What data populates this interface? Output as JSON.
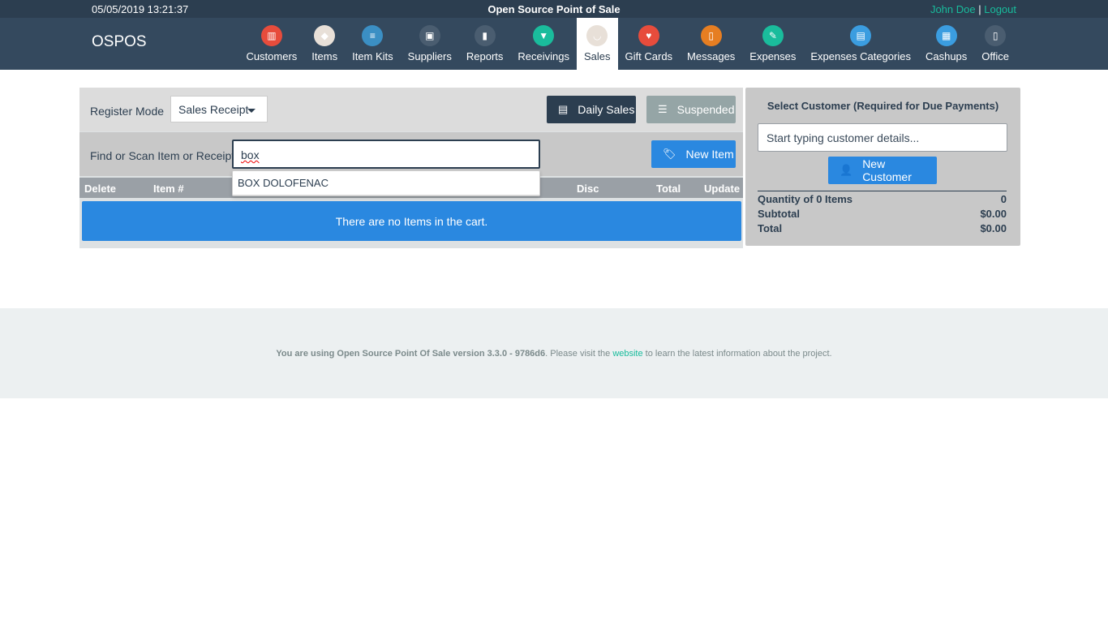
{
  "topbar": {
    "datetime": "05/05/2019 13:21:37",
    "title": "Open Source Point of Sale",
    "user": "John Doe",
    "separator": "|",
    "logout": "Logout"
  },
  "brand": "OSPOS",
  "nav": [
    {
      "label": "Customers",
      "icon": "customers-icon",
      "color": "#e74c3c"
    },
    {
      "label": "Items",
      "icon": "items-icon",
      "color": "#e8e0d8"
    },
    {
      "label": "Item Kits",
      "icon": "item-kits-icon",
      "color": "#3b8fc4"
    },
    {
      "label": "Suppliers",
      "icon": "suppliers-icon",
      "color": "#4a5d70"
    },
    {
      "label": "Reports",
      "icon": "reports-icon",
      "color": "#4a5d70"
    },
    {
      "label": "Receivings",
      "icon": "receivings-icon",
      "color": "#1abc9c"
    },
    {
      "label": "Sales",
      "icon": "sales-icon",
      "color": "#e8e0d8",
      "active": true
    },
    {
      "label": "Gift Cards",
      "icon": "gift-cards-icon",
      "color": "#e74c3c"
    },
    {
      "label": "Messages",
      "icon": "messages-icon",
      "color": "#e67e22"
    },
    {
      "label": "Expenses",
      "icon": "expenses-icon",
      "color": "#1abc9c"
    },
    {
      "label": "Expenses Categories",
      "icon": "expenses-categories-icon",
      "color": "#3b9de0"
    },
    {
      "label": "Cashups",
      "icon": "cashups-icon",
      "color": "#3b9de0"
    },
    {
      "label": "Office",
      "icon": "office-icon",
      "color": "#4a5d70"
    }
  ],
  "register": {
    "mode_label": "Register Mode",
    "mode_value": "Sales Receipt",
    "daily_sales": "Daily Sales",
    "suspended": "Suspended",
    "find_label": "Find or Scan Item or Receipt",
    "search_value": "box",
    "autocomplete_option": "BOX DOLOFENAC",
    "new_item": "New Item"
  },
  "table": {
    "headers": [
      "Delete",
      "Item #",
      "Disc",
      "Total",
      "Update"
    ],
    "empty_message": "There are no Items in the cart."
  },
  "customer": {
    "title": "Select Customer (Required for Due Payments)",
    "placeholder": "Start typing customer details...",
    "new_customer": "New Customer",
    "qty_label": "Quantity of 0 Items",
    "qty_value": "0",
    "subtotal_label": "Subtotal",
    "subtotal_value": "$0.00",
    "total_label": "Total",
    "total_value": "$0.00"
  },
  "footer": {
    "prefix": "You are using Open Source Point Of Sale version 3.3.0 - 9786d6",
    "middle": ". Please visit the ",
    "link": "website",
    "suffix": " to learn the latest information about the project."
  },
  "colors": {
    "navbar": "#34495e",
    "topbar": "#2c3e50",
    "primary": "#2a88e0",
    "accent": "#18bc9c"
  }
}
